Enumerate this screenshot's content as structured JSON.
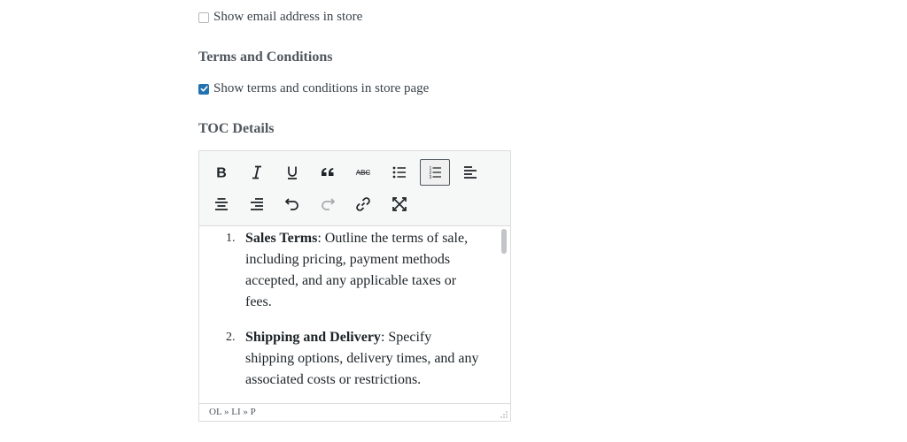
{
  "email_option": {
    "label": "Show email address in store",
    "checked": false
  },
  "terms_section": {
    "title": "Terms and Conditions"
  },
  "terms_option": {
    "label": "Show terms and conditions in store page",
    "checked": true
  },
  "toc_section": {
    "title": "TOC Details"
  },
  "toolbar": {
    "buttons": [
      {
        "name": "bold",
        "icon": "bold-icon"
      },
      {
        "name": "italic",
        "icon": "italic-icon"
      },
      {
        "name": "underline",
        "icon": "underline-icon"
      },
      {
        "name": "blockquote",
        "icon": "quote-icon"
      },
      {
        "name": "strikethrough",
        "icon": "strikethrough-icon",
        "text": "ABC"
      },
      {
        "name": "bullet-list",
        "icon": "bullet-list-icon"
      },
      {
        "name": "numbered-list",
        "icon": "numbered-list-icon",
        "active": true
      },
      {
        "name": "align-left",
        "icon": "align-left-icon"
      },
      {
        "name": "align-center",
        "icon": "align-center-icon"
      },
      {
        "name": "align-right",
        "icon": "align-right-icon"
      },
      {
        "name": "undo",
        "icon": "undo-icon"
      },
      {
        "name": "redo",
        "icon": "redo-icon",
        "disabled": true
      },
      {
        "name": "link",
        "icon": "link-icon"
      },
      {
        "name": "fullscreen",
        "icon": "fullscreen-icon"
      }
    ]
  },
  "content": {
    "items": [
      {
        "number": "1.",
        "title": "Sales Terms",
        "text": ": Outline the terms of sale, including pricing, payment methods accepted, and any applicable taxes or fees."
      },
      {
        "number": "2.",
        "title": "Shipping and Delivery",
        "text": ": Specify shipping options, delivery times, and any associated costs or restrictions."
      }
    ]
  },
  "statusbar": {
    "path": "OL » LI » P"
  },
  "colors": {
    "accent": "#2271b1",
    "toolbar_bg": "#f6f7f7",
    "border": "#dcdcde"
  }
}
